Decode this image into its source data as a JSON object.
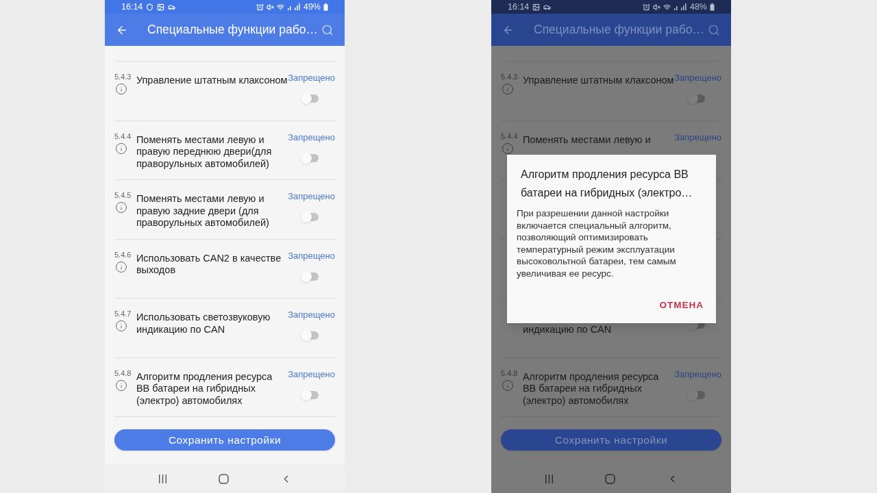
{
  "screens": [
    {
      "dimmed": false,
      "status_bar": {
        "time": "16:14",
        "notifications": [
          {
            "kind": "shield"
          },
          {
            "kind": "image"
          },
          {
            "kind": "car"
          }
        ],
        "battery": "49%"
      },
      "header": {
        "title": "Специальные функции рабо…"
      },
      "settings": [
        {
          "kind": "full",
          "number": "5.4.3",
          "title": "Управление штатным клаксоном",
          "status": "Запрещено",
          "on": false
        },
        {
          "kind": "full",
          "number": "5.4.4",
          "title": "Поменять местами левую и правую переднюю двери(для праворульных автомобилей)",
          "status": "Запрещено",
          "on": false
        },
        {
          "kind": "full",
          "number": "5.4.5",
          "title": "Поменять местами левую и правую задние двери (для праворульных автомобилей)",
          "status": "Запрещено",
          "on": false
        },
        {
          "kind": "full",
          "number": "5.4.6",
          "title": "Использовать CAN2 в качестве выходов",
          "status": "Запрещено",
          "on": false
        },
        {
          "kind": "full",
          "number": "5.4.7",
          "title": "Использовать светозвуковую индикацию по CAN",
          "status": "Запрещено",
          "on": false
        },
        {
          "kind": "full",
          "number": "5.4.8",
          "title": "Алгоритм продления ресурса ВВ батареи на гибридных (электро) автомобилях",
          "status": "Запрещено",
          "on": false
        }
      ],
      "save_button": "Сохранить настройки"
    },
    {
      "dimmed": true,
      "status_bar": {
        "time": "16:14",
        "notifications": [
          {
            "kind": "image"
          },
          {
            "kind": "car"
          }
        ],
        "battery": "48%"
      },
      "header": {
        "title": "Специальные функции рабо…"
      },
      "settings": [
        {
          "kind": "full",
          "number": "5.4.3",
          "title": "Управление штатным клаксоном",
          "status": "Запрещено",
          "on": false
        },
        {
          "kind": "top",
          "number": "5.4.4",
          "title": "Поменять местами левую и",
          "status": "Запрещено"
        },
        {
          "kind": "hidden"
        },
        {
          "kind": "hidden"
        },
        {
          "kind": "bottom",
          "title": "индикацию по CAN",
          "on": false
        },
        {
          "kind": "full",
          "number": "5.4.8",
          "title": "Алгоритм продления ресурса ВВ батареи на гибридных (электро) автомобилях",
          "status": "Запрещено",
          "on": false
        }
      ],
      "save_button": "Сохранить настройки",
      "dialog": {
        "title": "Алгоритм продления ресурса ВВ батареи на гибридных (электро…",
        "body": "При разрешении данной настройки включается специальный алгоритм, позволяющий оптимизировать температурный режим эксплуатации высоковольтной батареи, тем самым увеличивая ее ресурс.",
        "button": "ОТМЕНА"
      }
    }
  ]
}
